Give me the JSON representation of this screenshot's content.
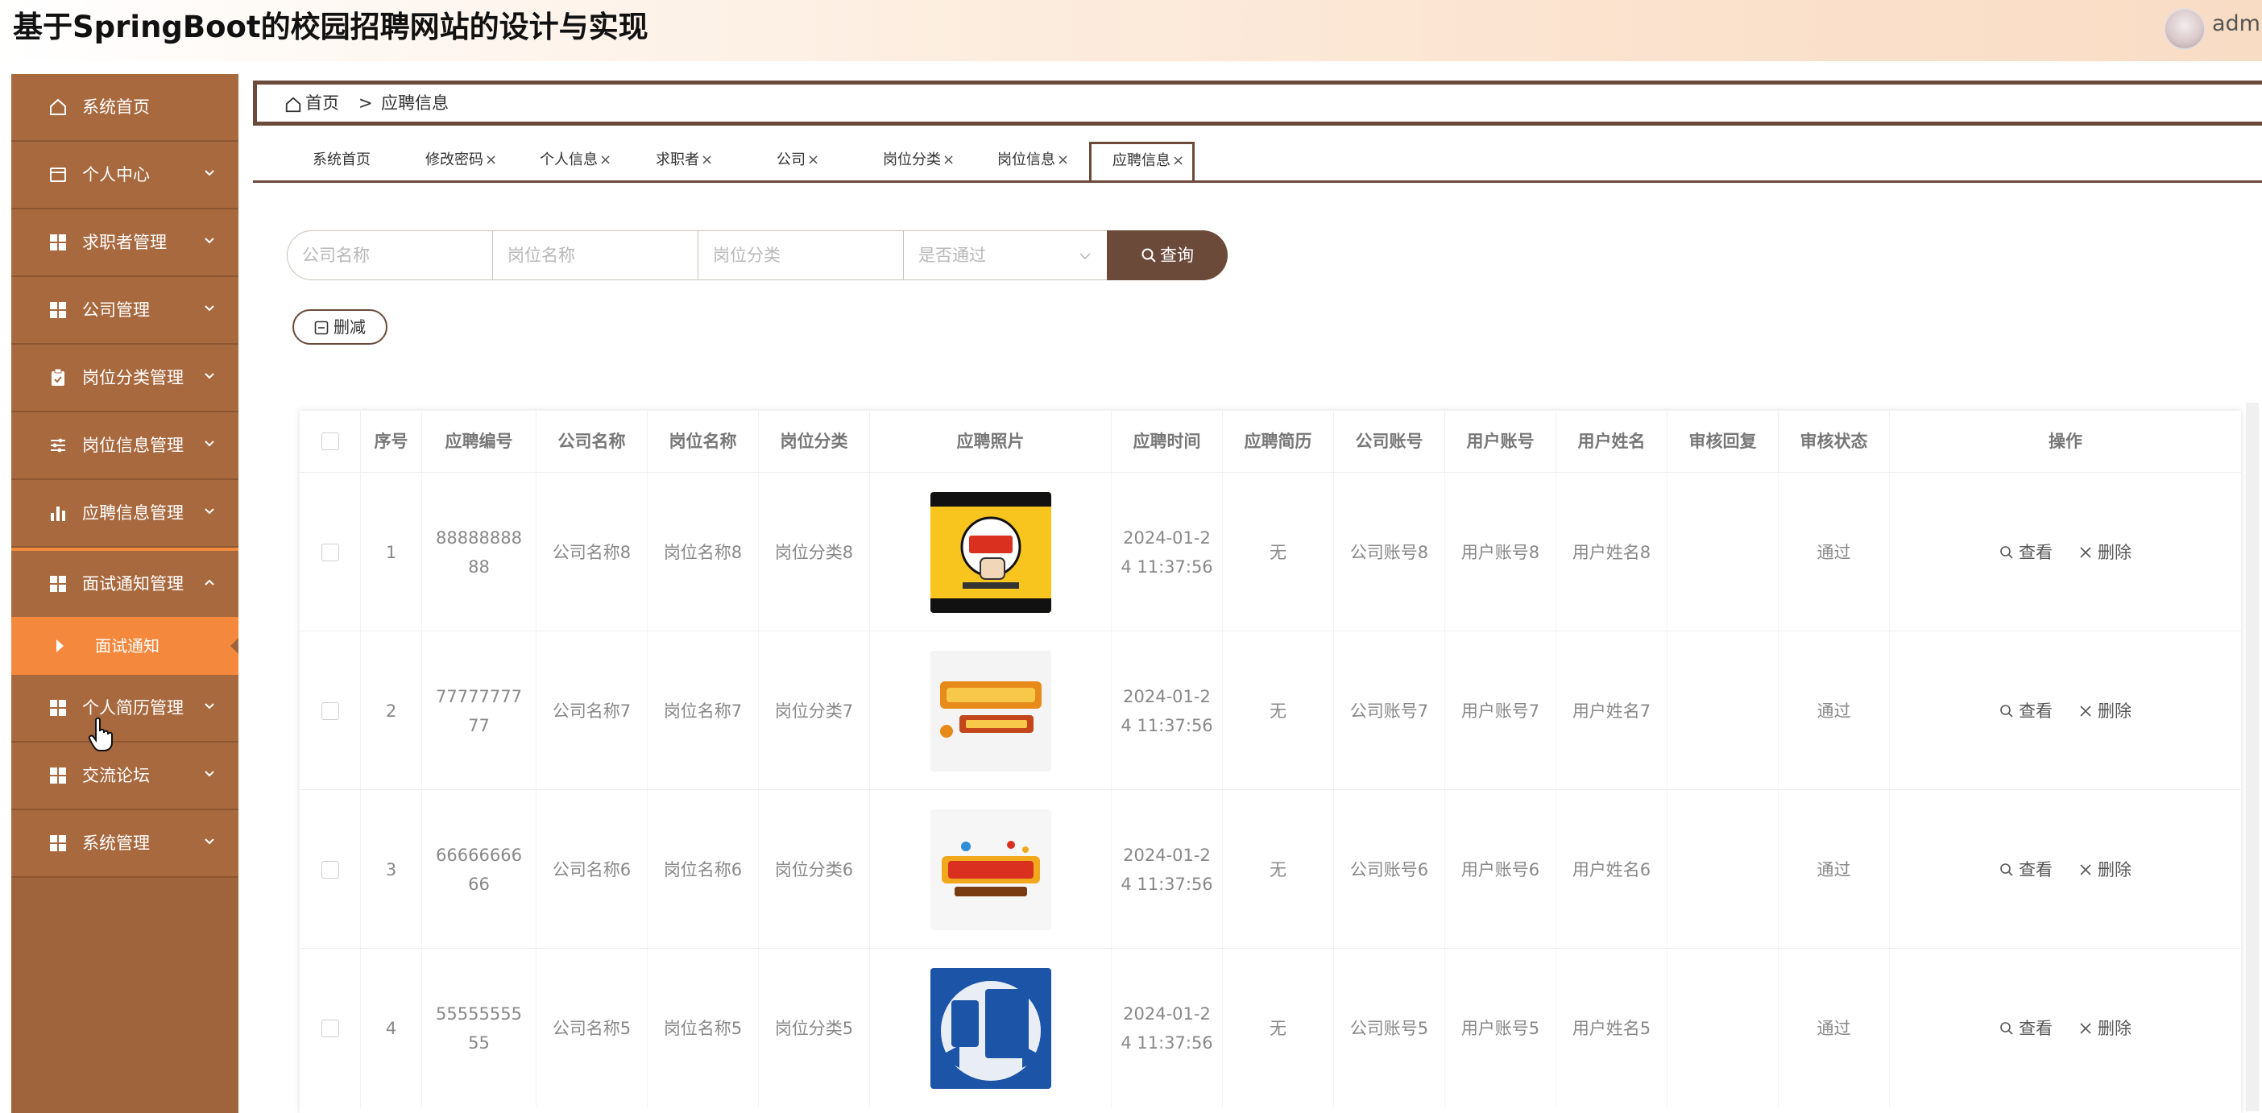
{
  "header": {
    "title": "基于SpringBoot的校园招聘网站的设计与实现",
    "user": "admin"
  },
  "sidebar": {
    "items": [
      {
        "label": "系统首页",
        "icon": "home-icon"
      },
      {
        "label": "个人中心",
        "icon": "calendar-icon"
      },
      {
        "label": "求职者管理",
        "icon": "grid-icon"
      },
      {
        "label": "公司管理",
        "icon": "grid-icon"
      },
      {
        "label": "岗位分类管理",
        "icon": "clipboard-icon"
      },
      {
        "label": "岗位信息管理",
        "icon": "sliders-icon"
      },
      {
        "label": "应聘信息管理",
        "icon": "bar-chart-icon"
      },
      {
        "label": "面试通知管理",
        "icon": "grid-icon"
      },
      {
        "label": "个人简历管理",
        "icon": "grid-icon"
      },
      {
        "label": "交流论坛",
        "icon": "grid-icon"
      },
      {
        "label": "系统管理",
        "icon": "grid-icon"
      }
    ],
    "submenu": {
      "label": "面试通知"
    }
  },
  "breadcrumb": {
    "home": "首页",
    "separator": ">",
    "current": "应聘信息"
  },
  "tabs": [
    {
      "label": "系统首页",
      "closable": false
    },
    {
      "label": "修改密码",
      "closable": true
    },
    {
      "label": "个人信息",
      "closable": true
    },
    {
      "label": "求职者",
      "closable": true
    },
    {
      "label": "公司",
      "closable": true
    },
    {
      "label": "岗位分类",
      "closable": true
    },
    {
      "label": "岗位信息",
      "closable": true
    },
    {
      "label": "应聘信息",
      "closable": true,
      "active": true
    }
  ],
  "close_glyph": "×",
  "search": {
    "company_placeholder": "公司名称",
    "position_placeholder": "岗位名称",
    "category_placeholder": "岗位分类",
    "passed_placeholder": "是否通过",
    "button": "查询"
  },
  "actions": {
    "delete_batch": "删减"
  },
  "table": {
    "columns": [
      "序号",
      "应聘编号",
      "公司名称",
      "岗位名称",
      "岗位分类",
      "应聘照片",
      "应聘时间",
      "应聘简历",
      "公司账号",
      "用户账号",
      "用户姓名",
      "审核回复",
      "审核状态",
      "操作"
    ],
    "view_label": "查看",
    "delete_label": "删除",
    "rows": [
      {
        "index": "1",
        "code_a": "88888888",
        "code_b": "88",
        "company": "公司名称8",
        "position": "岗位名称8",
        "category": "岗位分类8",
        "photo": "poster-join-us",
        "time_a": "2024-01-2",
        "time_b": "4 11:37:56",
        "resume": "无",
        "company_account": "公司账号8",
        "user_account": "用户账号8",
        "user_name": "用户姓名8",
        "reply": "",
        "status": "通过"
      },
      {
        "index": "2",
        "code_a": "77777777",
        "code_b": "77",
        "company": "公司名称7",
        "position": "岗位名称7",
        "category": "岗位分类7",
        "photo": "poster-recruit-talent",
        "time_a": "2024-01-2",
        "time_b": "4 11:37:56",
        "resume": "无",
        "company_account": "公司账号7",
        "user_account": "用户账号7",
        "user_name": "用户姓名7",
        "reply": "",
        "status": "通过"
      },
      {
        "index": "3",
        "code_a": "66666666",
        "code_b": "66",
        "company": "公司名称6",
        "position": "岗位名称6",
        "category": "岗位分类6",
        "photo": "poster-high-salary",
        "time_a": "2024-01-2",
        "time_b": "4 11:37:56",
        "resume": "无",
        "company_account": "公司账号6",
        "user_account": "用户账号6",
        "user_name": "用户姓名6",
        "reply": "",
        "status": "通过"
      },
      {
        "index": "4",
        "code_a": "55555555",
        "code_b": "55",
        "company": "公司名称5",
        "position": "岗位名称5",
        "category": "岗位分类5",
        "photo": "poster-hiring-sign",
        "time_a": "2024-01-2",
        "time_b": "4 11:37:56",
        "resume": "无",
        "company_account": "公司账号5",
        "user_account": "用户账号5",
        "user_name": "用户姓名5",
        "reply": "",
        "status": "通过"
      }
    ]
  },
  "colors": {
    "sidebar": "#a0643c",
    "accent_orange": "#f4883c",
    "primary_brown": "#6b4a3a"
  }
}
